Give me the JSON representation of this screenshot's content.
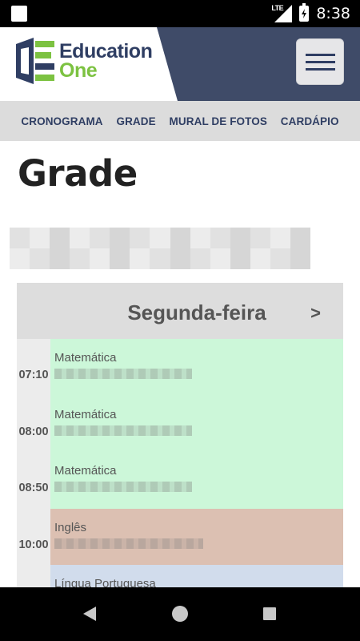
{
  "status_bar": {
    "network": "LTE",
    "time": "8:38"
  },
  "header": {
    "logo_line1": "Education",
    "logo_line2": "One",
    "colors": {
      "brand_dark": "#2f3e63",
      "brand_green": "#7cc241",
      "header_bg": "#3f4b68"
    }
  },
  "nav": {
    "items": [
      {
        "label": "CRONOGRAMA"
      },
      {
        "label": "GRADE"
      },
      {
        "label": "MURAL DE FOTOS"
      },
      {
        "label": "CARDÁPIO"
      }
    ]
  },
  "page": {
    "title": "Grade"
  },
  "schedule": {
    "day": "Segunda-feira",
    "next_label": ">",
    "rows": [
      {
        "time": "07:10",
        "subject": "Matemática",
        "color": "#ccf7d9"
      },
      {
        "time": "08:00",
        "subject": "Matemática",
        "color": "#ccf7d9"
      },
      {
        "time": "08:50",
        "subject": "Matemática",
        "color": "#ccf7d9"
      },
      {
        "time": "10:00",
        "subject": "Inglês",
        "color": "#dcc0b2"
      },
      {
        "time": "",
        "subject": "Língua Portuguesa",
        "color": "#d1dcec"
      }
    ]
  }
}
